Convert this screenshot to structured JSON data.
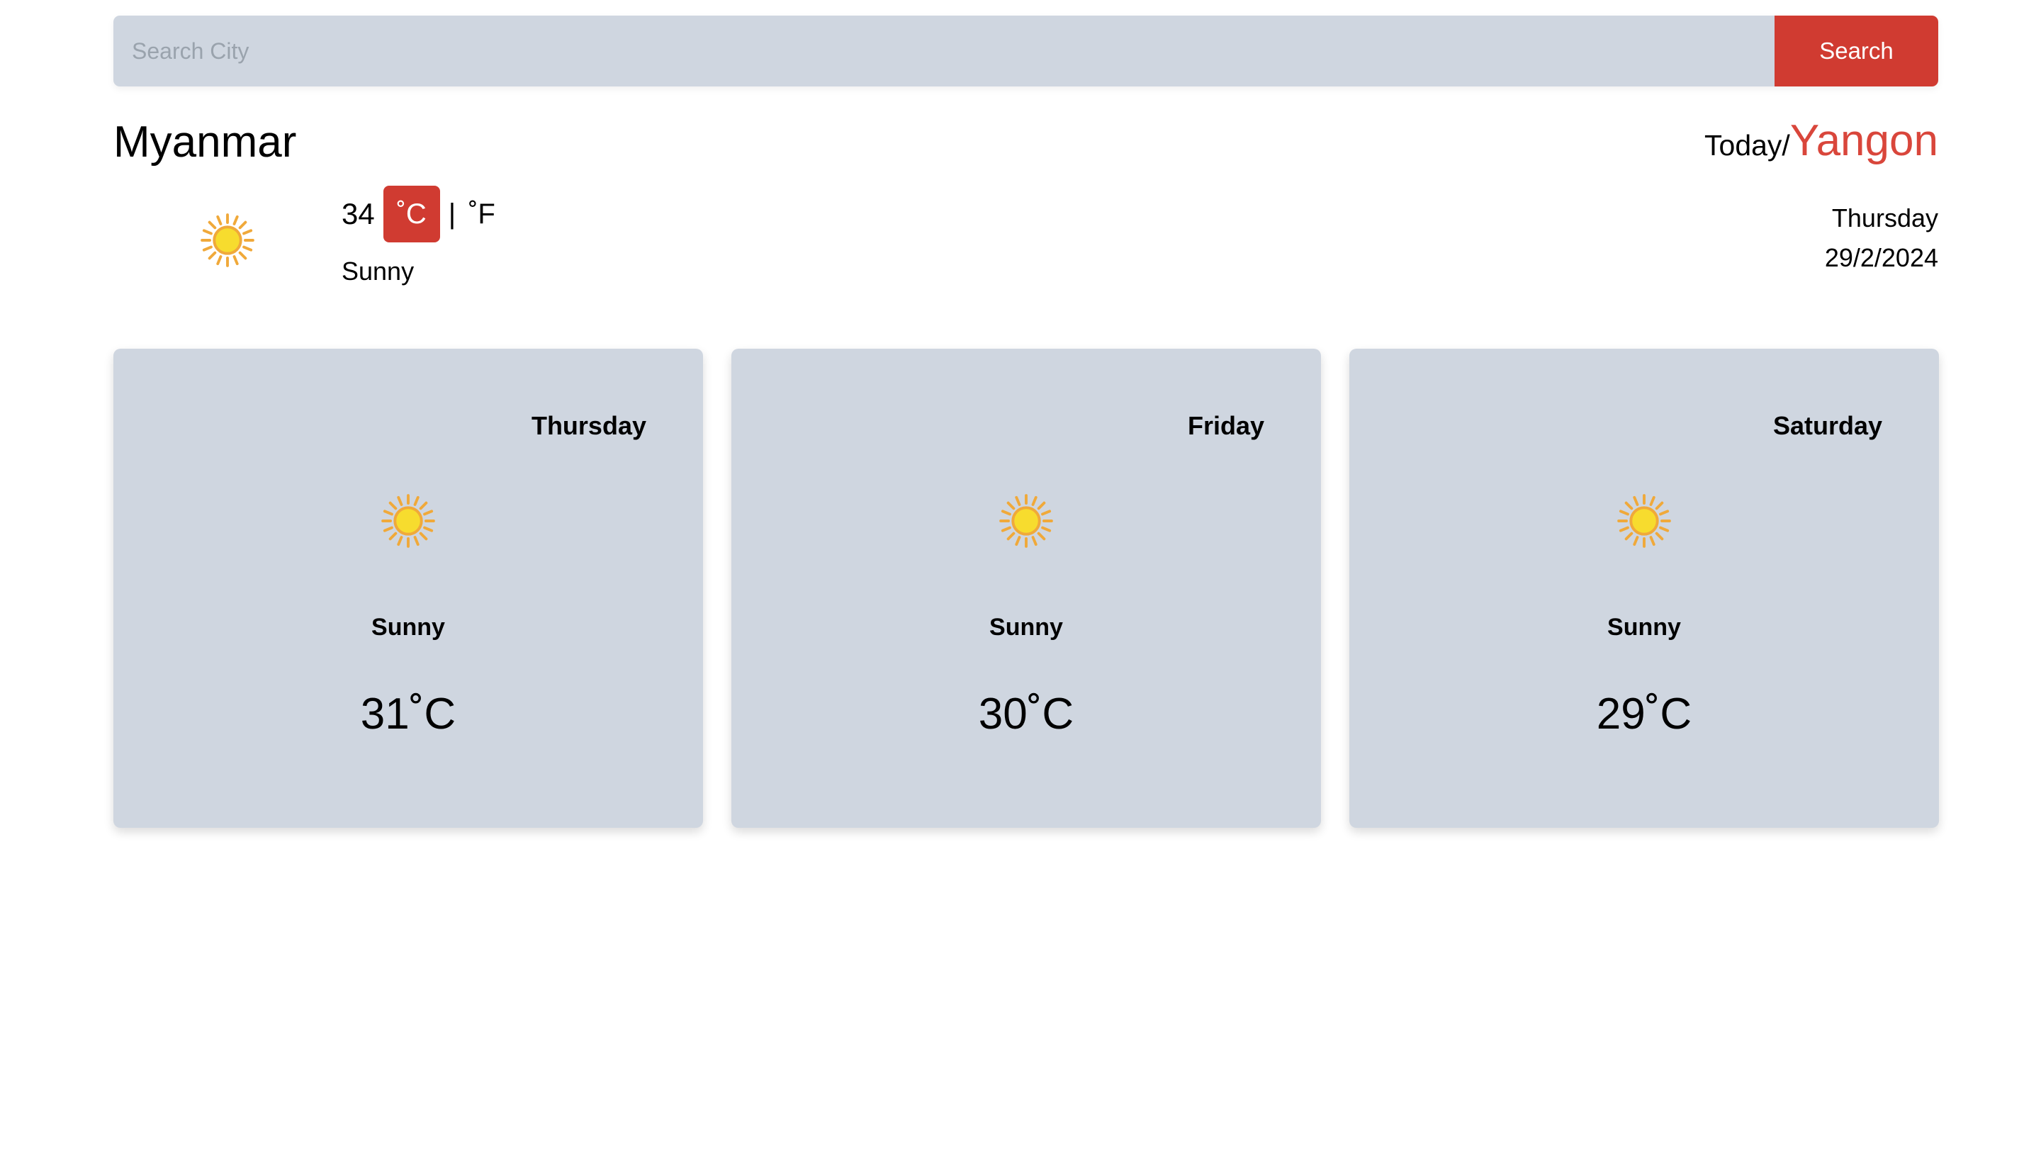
{
  "search": {
    "placeholder": "Search City",
    "value": "",
    "button_label": "Search"
  },
  "header": {
    "country": "Myanmar",
    "today_label": "Today/",
    "city": "Yangon"
  },
  "current": {
    "icon": "sun-icon",
    "temperature": "34",
    "unit_celsius": "˚C",
    "separator": "|",
    "unit_fahrenheit": "˚F",
    "active_unit": "celsius",
    "condition": "Sunny",
    "day": "Thursday",
    "date": "29/2/2024"
  },
  "forecast": [
    {
      "day": "Thursday",
      "icon": "sun-icon",
      "condition": "Sunny",
      "temp": "31˚C"
    },
    {
      "day": "Friday",
      "icon": "sun-icon",
      "condition": "Sunny",
      "temp": "30˚C"
    },
    {
      "day": "Saturday",
      "icon": "sun-icon",
      "condition": "Sunny",
      "temp": "29˚C"
    }
  ],
  "colors": {
    "accent": "#d03b31",
    "city": "#d9463b",
    "card_bg": "#cfd6e0",
    "sun_core": "#f7dc2e",
    "sun_rays": "#f0a93a"
  }
}
